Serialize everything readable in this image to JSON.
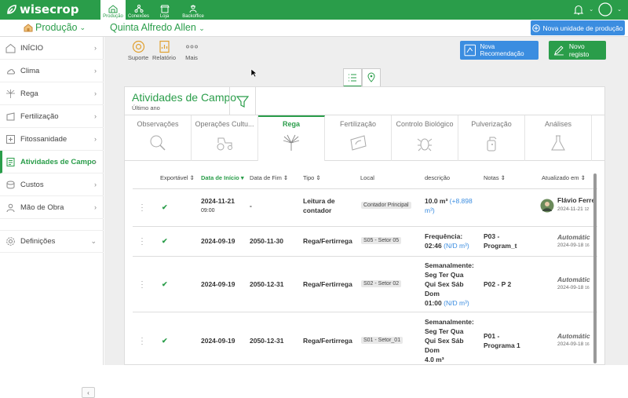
{
  "app": {
    "name": "wisecrop"
  },
  "topnav": {
    "tabs": [
      {
        "label": "Produção",
        "active": true
      },
      {
        "label": "Conexões"
      },
      {
        "label": "Loja"
      },
      {
        "label": "Backoffice"
      }
    ]
  },
  "header": {
    "module": "Produção",
    "farm": "Quinta Alfredo Allen",
    "new_unit_label": "Nova unidade de produção"
  },
  "sidebar": {
    "items": [
      {
        "label": "INÍCIO",
        "icon": "home-icon"
      },
      {
        "label": "Clima",
        "icon": "cloud-icon"
      },
      {
        "label": "Rega",
        "icon": "sprinkler-icon"
      },
      {
        "label": "Fertilização",
        "icon": "fertilizer-icon"
      },
      {
        "label": "Fitossanidade",
        "icon": "plus-box-icon"
      },
      {
        "label": "Atividades de Campo",
        "icon": "field-activities-icon",
        "active": true
      },
      {
        "label": "Custos",
        "icon": "coins-icon"
      },
      {
        "label": "Mão de Obra",
        "icon": "worker-icon"
      },
      {
        "label": "Definições",
        "icon": "gear-icon"
      }
    ]
  },
  "toolbar": {
    "suporte": "Suporte",
    "relatorio": "Relatório",
    "mais": "Mais",
    "nova_recomendacao": "Nova Recomendação",
    "novo_registo": "Novo registo"
  },
  "card": {
    "title": "Atividades de Campo",
    "subtitle": "Último ano"
  },
  "categories": [
    "Observações",
    "Operações Cultu...",
    "Rega",
    "Fertilização",
    "Controlo Biológico",
    "Pulverização",
    "Análises"
  ],
  "table": {
    "headers": {
      "exportavel": "Exportável ⇕",
      "data_inicio": "Data de Início ▾",
      "data_fim": "Data de Fim ⇕",
      "tipo": "Tipo ⇕",
      "local": "Local",
      "descricao": "descrição",
      "notas": "Notas ⇕",
      "atualizado": "Atualizado em ⇕"
    },
    "rows": [
      {
        "check": "✔",
        "data_inicio": "2024-11-21",
        "hora": "09:00",
        "data_fim": "-",
        "tipo_1": "Leitura de",
        "tipo_2": "contador",
        "local": "Contador Principal",
        "desc_1": "10.0 m³",
        "desc_blue": "(+8.898",
        "desc_2": "m³)",
        "notas_1": "",
        "notas_2": "",
        "upd_name": "Flávio Ferre",
        "upd_date": "2024-11-21",
        "upd_time": "12"
      },
      {
        "check": "✔",
        "data_inicio": "2024-09-19",
        "data_fim": "2050-11-30",
        "tipo": "Rega/Fertirrega",
        "local": "S05 - Setor 05",
        "desc_1": "Frequência:",
        "desc_2": "02:46",
        "desc_blue": "(N/D m³)",
        "notas_1": "P03 -",
        "notas_2": "Program_t",
        "upd_name": "Automátic",
        "upd_date": "2024-09-18",
        "upd_time": "16"
      },
      {
        "check": "✔",
        "data_inicio": "2024-09-19",
        "data_fim": "2050-12-31",
        "tipo": "Rega/Fertirrega",
        "local": "S02 - Setor 02",
        "desc_1": "Semanalmente:",
        "desc_2": "Seg Ter Qua",
        "desc_3": "Qui Sex Sáb",
        "desc_4": "Dom",
        "desc_5": "01:00",
        "desc_blue": "(N/D m³)",
        "notas": "P02 - P 2",
        "upd_name": "Automátic",
        "upd_date": "2024-09-18",
        "upd_time": "16"
      },
      {
        "check": "✔",
        "data_inicio": "2024-09-19",
        "data_fim": "2050-12-31",
        "tipo": "Rega/Fertirrega",
        "local": "S01 - Setor_01",
        "desc_1": "Semanalmente:",
        "desc_2": "Seg Ter Qua",
        "desc_3": "Qui Sex Sáb",
        "desc_4": "Dom",
        "desc_5": "4.0 m³",
        "notas_1": "P01 -",
        "notas_2": "Programa 1",
        "upd_name": "Automátic",
        "upd_date": "2024-09-18",
        "upd_time": "16"
      }
    ]
  },
  "colors": {
    "brand": "#2a9d4a",
    "accent": "#3b8de0"
  }
}
